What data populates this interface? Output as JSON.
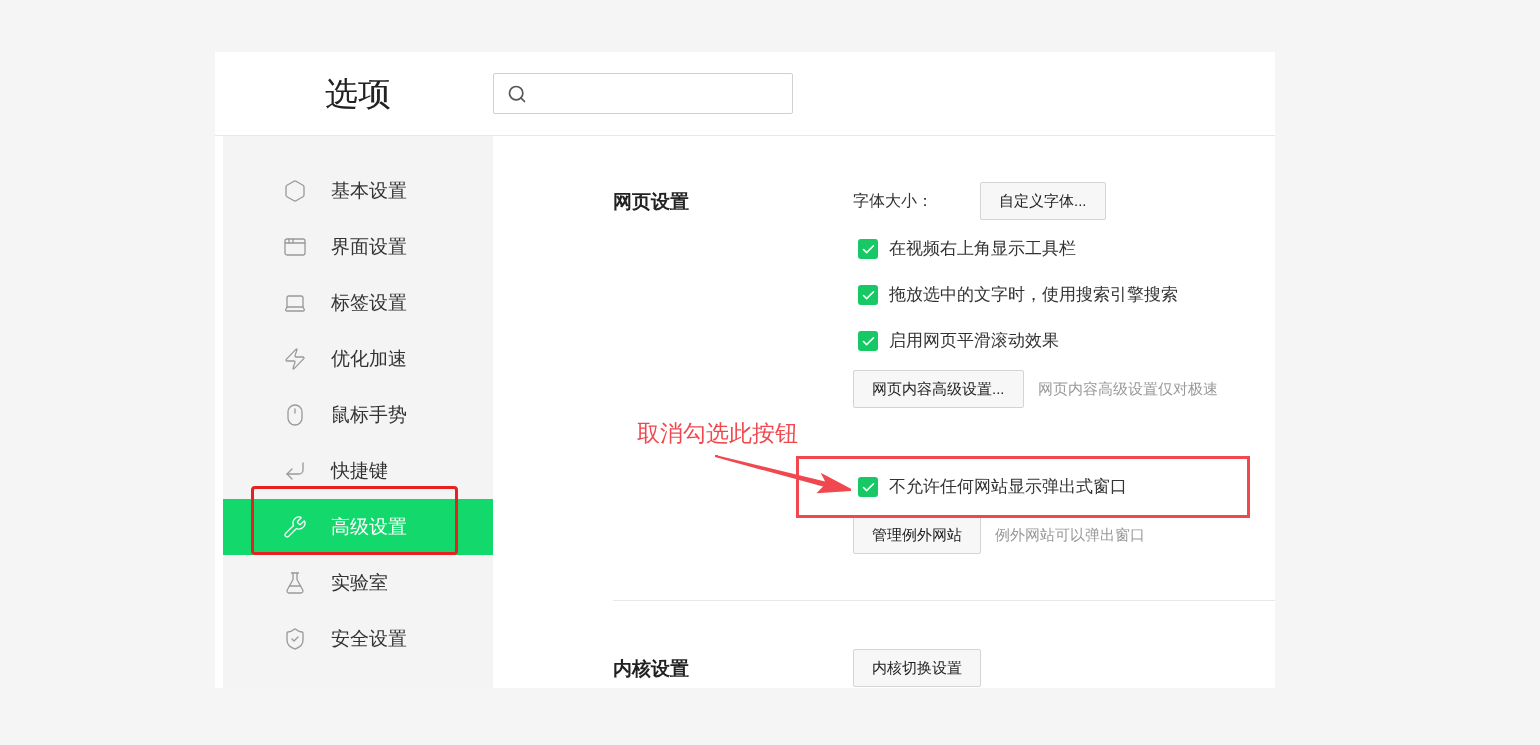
{
  "window": {
    "title": "选项"
  },
  "sidebar": {
    "items": [
      {
        "label": "基本设置",
        "selected": false
      },
      {
        "label": "界面设置",
        "selected": false
      },
      {
        "label": "标签设置",
        "selected": false
      },
      {
        "label": "优化加速",
        "selected": false
      },
      {
        "label": "鼠标手势",
        "selected": false
      },
      {
        "label": "快捷键",
        "selected": false
      },
      {
        "label": "高级设置",
        "selected": true
      },
      {
        "label": "实验室",
        "selected": false
      },
      {
        "label": "安全设置",
        "selected": false
      }
    ]
  },
  "sections": [
    {
      "title": "网页设置",
      "rows": [
        {
          "kind": "button",
          "label": "字体大小：",
          "button": "自定义字体..."
        },
        {
          "kind": "checkbox",
          "label": "在视频右上角显示工具栏",
          "checked": true,
          "highlighted": false
        },
        {
          "kind": "checkbox",
          "label": "拖放选中的文字时，使用搜索引擎搜索",
          "checked": true,
          "highlighted": false
        },
        {
          "kind": "checkbox",
          "label": "启用网页平滑滚动效果",
          "checked": true,
          "highlighted": false
        },
        {
          "kind": "button",
          "button": "网页内容高级设置...",
          "note": "网页内容高级设置仅对极速"
        },
        {
          "kind": "checkbox",
          "label": "不允许任何网站显示弹出式窗口",
          "checked": true,
          "highlighted": true
        },
        {
          "kind": "button",
          "button": "管理例外网站",
          "note": "例外网站可以弹出窗口"
        }
      ]
    },
    {
      "title": "内核设置",
      "rows": [
        {
          "kind": "button",
          "button": "内核切换设置"
        }
      ]
    }
  ],
  "annotation": {
    "text": "取消勾选此按钮"
  }
}
